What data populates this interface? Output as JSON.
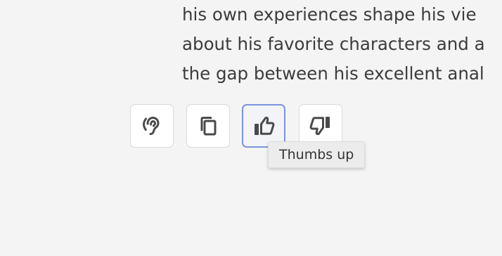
{
  "message": {
    "lines": [
      "his own experiences shape his vie",
      "about his favorite characters and a",
      "the gap between his excellent anal"
    ]
  },
  "actions": [
    {
      "name": "listen",
      "icon": "ear-icon",
      "tooltip": ""
    },
    {
      "name": "copy",
      "icon": "copy-icon",
      "tooltip": ""
    },
    {
      "name": "thumbs-up",
      "icon": "thumbs-up-icon",
      "tooltip": "Thumbs up",
      "active": true
    },
    {
      "name": "thumbs-down",
      "icon": "thumbs-down-icon",
      "tooltip": ""
    }
  ],
  "tooltip": {
    "text": "Thumbs up"
  },
  "colors": {
    "text": "#3c3c3c",
    "icon": "#4a4a4a",
    "active_border": "#7b93de",
    "background": "#f4f4f4"
  }
}
